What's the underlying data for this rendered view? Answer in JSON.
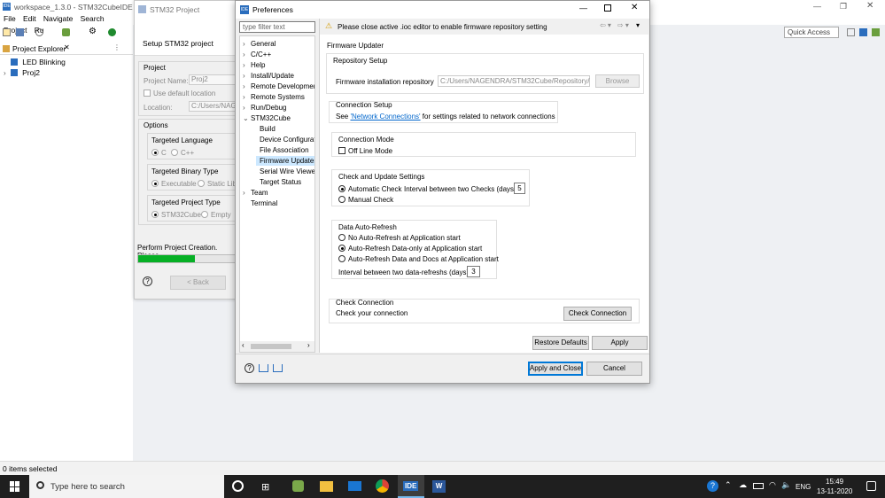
{
  "window": {
    "title": "workspace_1.3.0 - STM32CubeIDE",
    "quick_access": "Quick Access"
  },
  "menu": [
    "File",
    "Edit",
    "Navigate",
    "Search",
    "Project",
    "Ru"
  ],
  "explorer": {
    "title": "Project Explorer",
    "items": [
      {
        "label": "LED Blinking"
      },
      {
        "label": "Proj2"
      }
    ]
  },
  "wizard": {
    "title": "STM32 Project",
    "header": "Setup STM32 project",
    "project_group": "Project",
    "project_name_label": "Project Name:",
    "project_name_value": "Proj2",
    "use_default_location": "Use default location",
    "location_label": "Location:",
    "location_value": "C:/Users/NAGE",
    "options_group": "Options",
    "targeted_language": "Targeted Language",
    "lang_c": "C",
    "lang_cpp": "C++",
    "targeted_binary_type": "Targeted Binary Type",
    "bin_exec": "Executable",
    "bin_static": "Static Lib",
    "targeted_project_type": "Targeted Project Type",
    "type_cube": "STM32Cube",
    "type_empty": "Empty",
    "progress_text": "Perform Project Creation. Please",
    "progress_fraction": 0.58,
    "back_label": "< Back"
  },
  "prefs": {
    "title": "Preferences",
    "filter_placeholder": "type filter text",
    "tree": [
      {
        "label": "General",
        "level": 0,
        "expander": "›"
      },
      {
        "label": "C/C++",
        "level": 0,
        "expander": "›"
      },
      {
        "label": "Help",
        "level": 0,
        "expander": "›"
      },
      {
        "label": "Install/Update",
        "level": 0,
        "expander": "›"
      },
      {
        "label": "Remote Development",
        "level": 0,
        "expander": "›"
      },
      {
        "label": "Remote Systems",
        "level": 0,
        "expander": "›"
      },
      {
        "label": "Run/Debug",
        "level": 0,
        "expander": "›"
      },
      {
        "label": "STM32Cube",
        "level": 0,
        "expander": "⌄"
      },
      {
        "label": "Build",
        "level": 1,
        "expander": ""
      },
      {
        "label": "Device Configuration",
        "level": 1,
        "expander": ""
      },
      {
        "label": "File Association",
        "level": 1,
        "expander": ""
      },
      {
        "label": "Firmware Updater",
        "level": 1,
        "expander": "",
        "selected": true
      },
      {
        "label": "Serial Wire Viewer",
        "level": 1,
        "expander": ""
      },
      {
        "label": "Target Status",
        "level": 1,
        "expander": ""
      },
      {
        "label": "Team",
        "level": 0,
        "expander": "›"
      },
      {
        "label": "Terminal",
        "level": 0,
        "expander": ""
      }
    ],
    "warning": "Please close active .ioc editor to enable firmware repository setting",
    "page_title": "Firmware Updater",
    "repo_setup": "Repository Setup",
    "repo_label": "Firmware installation repository",
    "repo_value": "C:/Users/NAGENDRA/STM32Cube/Repository/",
    "browse": "Browse",
    "conn_setup": "Connection Setup",
    "conn_see": "See",
    "conn_link": "'Network Connections'",
    "conn_rest": "for settings related to network connections",
    "conn_mode": "Connection Mode",
    "offline": "Off Line Mode",
    "check_update": "Check and Update Settings",
    "auto_check": "Automatic Check",
    "interval_checks": "Interval between two Checks (days)",
    "interval_checks_value": "5",
    "manual_check": "Manual Check",
    "data_refresh": "Data Auto-Refresh",
    "no_refresh": "No Auto-Refresh at Application start",
    "refresh_data": "Auto-Refresh Data-only at Application start",
    "refresh_all": "Auto-Refresh Data and Docs at Application start",
    "interval_refresh": "Interval between two data-refreshs (days)",
    "interval_refresh_value": "3",
    "check_conn": "Check Connection",
    "check_your": "Check your connection",
    "check_conn_btn": "Check Connection",
    "restore": "Restore Defaults",
    "apply": "Apply",
    "apply_close": "Apply and Close",
    "cancel": "Cancel"
  },
  "status": {
    "text": "0 items selected"
  },
  "taskbar": {
    "search_placeholder": "Type here to search",
    "ide_label": "IDE",
    "lang": "ENG",
    "time": "15:49",
    "date": "13-11-2020"
  },
  "colors": {
    "accent": "#0078d7",
    "progress": "#06b025",
    "selected": "#cce8ff"
  }
}
